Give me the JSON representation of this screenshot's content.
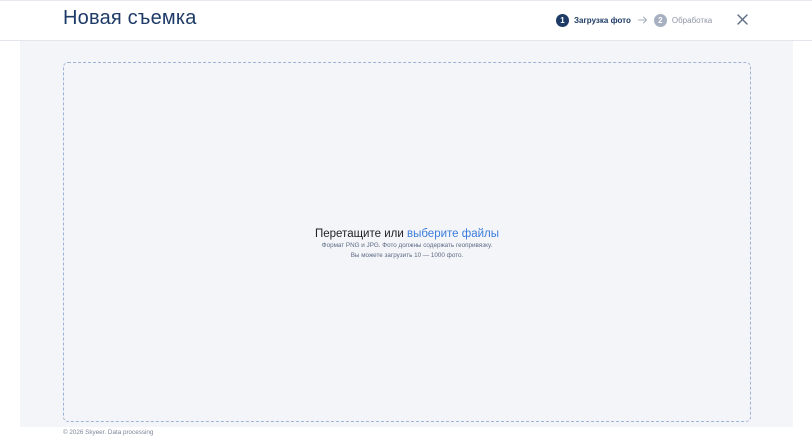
{
  "header": {
    "title": "Новая съемка",
    "steps": [
      {
        "number": "1",
        "label": "Загрузка фото",
        "state": "active"
      },
      {
        "number": "2",
        "label": "Обработка",
        "state": "inactive"
      }
    ],
    "arrow_icon": "arrow-right-icon",
    "close_icon": "close-icon"
  },
  "dropzone": {
    "title_prefix": "Перетащите или",
    "title_link": "выберите файлы",
    "hint_line1": "Формат PNG и JPG. Фото должны содержать геопривязку.",
    "hint_line2": "Вы можете загрузить 10 — 1000 фото."
  },
  "footer": {
    "text": "© 2026 Skyeer. Data processing"
  },
  "colors": {
    "primary": "#1d3b66",
    "link": "#3b7ddd",
    "background": "#f4f5f8",
    "dropzone_border": "#9fb3d6"
  }
}
